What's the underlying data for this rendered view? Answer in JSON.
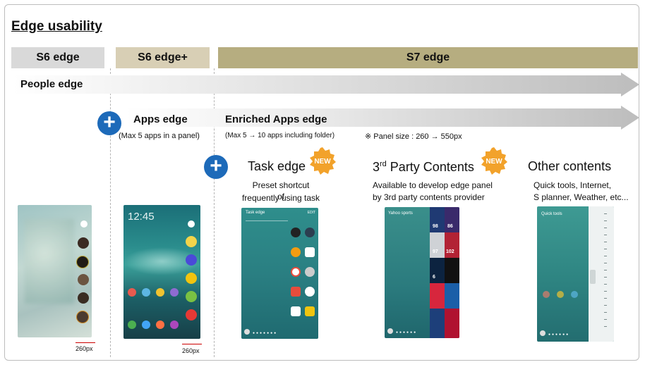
{
  "title": "Edge usability",
  "headers": {
    "s6": "S6 edge",
    "s6plus": "S6 edge+",
    "s7": "S7 edge"
  },
  "rows": {
    "people": "People edge",
    "apps": "Apps edge",
    "apps_note": "(Max 5 apps in a panel)",
    "enriched": "Enriched Apps edge",
    "enriched_note": "(Max 5 → 10 apps including folder)",
    "panel_size": "※ Panel size : 260 → 550px"
  },
  "features": {
    "task": {
      "title": "Task edge",
      "desc1": "Preset shortcut of",
      "desc2": "frequently using task",
      "badge": "NEW"
    },
    "third": {
      "title_main": "3",
      "title_sup": "rd",
      "title_rest": " Party Contents",
      "desc1": "Available to develop edge panel",
      "desc2": "by 3rd party contents provider",
      "badge": "NEW"
    },
    "other": {
      "title": "Other contents",
      "desc1": "Quick tools, Internet,",
      "desc2": "S planner, Weather, etc..."
    }
  },
  "screens": {
    "s7_task": {
      "header": "Task edge",
      "edit": "EDIT"
    },
    "s7_third": {
      "header": "Yahoo sports",
      "scores": [
        "98",
        "86",
        "97",
        "102",
        "6",
        "",
        "",
        ""
      ]
    },
    "s7_other": {
      "header": "Quick tools"
    },
    "s6plus_time": "12:45"
  },
  "dimensions": {
    "s6": "260px",
    "s6plus": "260px"
  },
  "colors": {
    "header_s6": "#d9d9d9",
    "header_s6plus": "#d8cfb5",
    "header_s7": "#b6ad80",
    "plus": "#1d6ab9",
    "badge": "#f2a22b"
  }
}
